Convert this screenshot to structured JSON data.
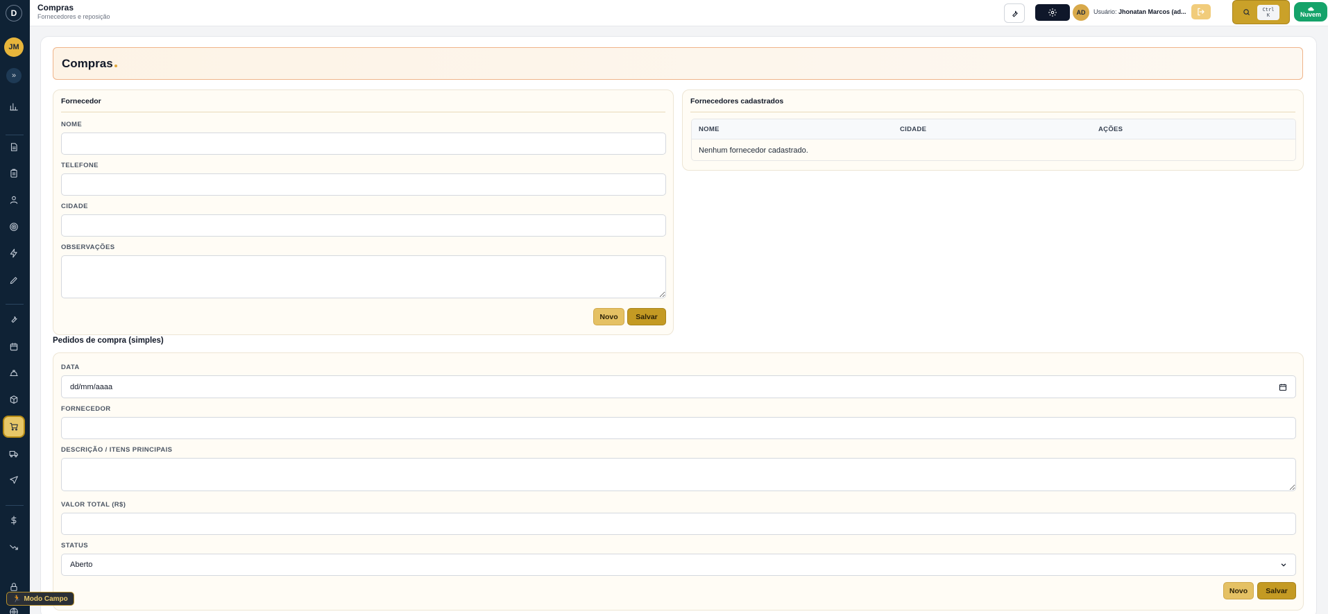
{
  "header": {
    "title": "Compras",
    "subtitle": "Fornecedores e reposição",
    "user_avatar": "AD",
    "user_prefix": "Usuário:",
    "user_name": "Jhonatan Marcos (ad...",
    "kbd_top": "Ctrl",
    "kbd_bottom": "K",
    "cloud_label": "Nuvem"
  },
  "sidebar": {
    "logo": "D",
    "avatar": "JM",
    "expand": "»",
    "modo_campo": "Modo Campo",
    "accent_color": "#e7c768"
  },
  "page": {
    "heading": "Compras"
  },
  "fornecedor_form": {
    "title": "Fornecedor",
    "nome_label": "NOME",
    "nome_value": "",
    "telefone_label": "TELEFONE",
    "telefone_value": "",
    "cidade_label": "CIDADE",
    "cidade_value": "",
    "obs_label": "OBSERVAÇÕES",
    "obs_value": "",
    "novo_label": "Novo",
    "salvar_label": "Salvar"
  },
  "fornecedores_table": {
    "title": "Fornecedores cadastrados",
    "columns": [
      "NOME",
      "CIDADE",
      "AÇÕES"
    ],
    "empty_message": "Nenhum fornecedor cadastrado."
  },
  "pedidos": {
    "section_title": "Pedidos de compra (simples)",
    "data_label": "DATA",
    "data_placeholder": "dd/mm/aaaa",
    "fornecedor_label": "FORNECEDOR",
    "fornecedor_value": "",
    "descricao_label": "DESCRIÇÃO / ITENS PRINCIPAIS",
    "descricao_value": "",
    "valor_label": "VALOR TOTAL (R$)",
    "valor_value": "",
    "status_label": "STATUS",
    "status_value": "Aberto",
    "novo_label": "Novo",
    "salvar_label": "Salvar"
  }
}
